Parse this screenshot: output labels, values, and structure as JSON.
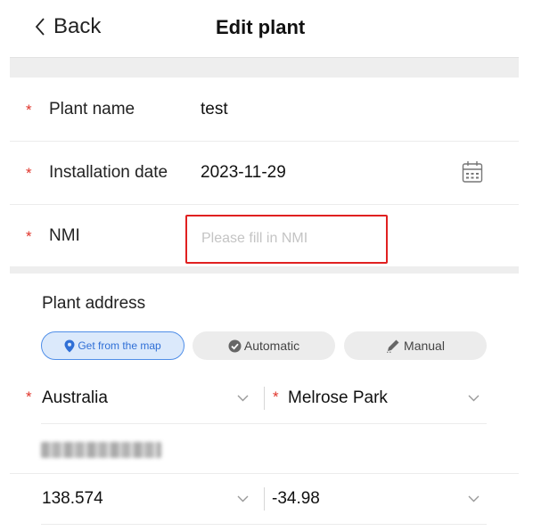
{
  "header": {
    "back_label": "Back",
    "title": "Edit plant"
  },
  "form": {
    "plant_name": {
      "label": "Plant name",
      "value": "test"
    },
    "installation_date": {
      "label": "Installation date",
      "value": "2023-11-29"
    },
    "nmi": {
      "label": "NMI",
      "value": "",
      "placeholder": "Please fill in NMI"
    }
  },
  "address": {
    "section_label": "Plant address",
    "modes": [
      "Get from the map",
      "Automatic",
      "Manual"
    ],
    "selected_mode": "Get from the map",
    "country": "Australia",
    "suburb": "Melrose Park",
    "longitude": "138.574",
    "latitude": "-34.98"
  },
  "colors": {
    "required": "#e0352b",
    "accent": "#2f6fd6",
    "highlight_border": "#e02020"
  },
  "icons": {
    "back": "chevron-left-icon",
    "date": "calendar-icon",
    "map": "location-pin-icon",
    "auto": "check-circle-icon",
    "manual": "pencil-icon",
    "dropdown": "chevron-down-icon"
  }
}
